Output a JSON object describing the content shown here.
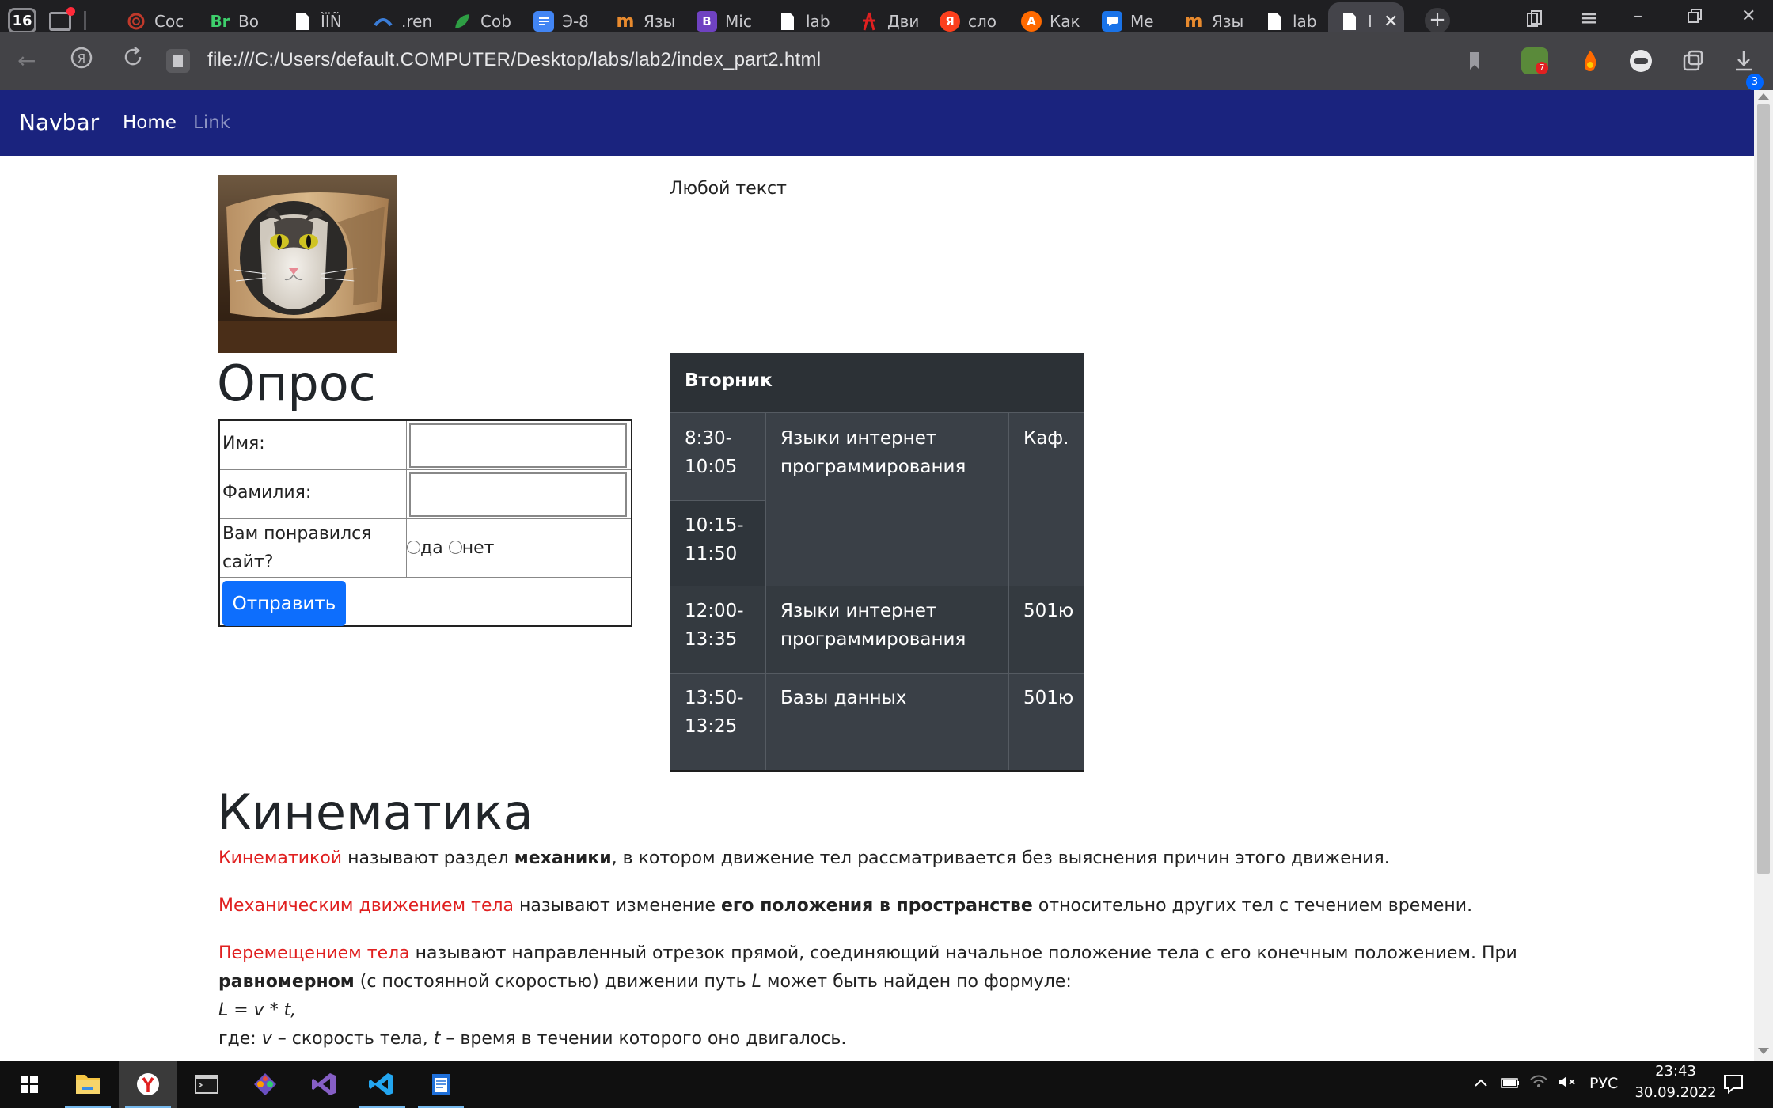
{
  "browser": {
    "tab_count": "16",
    "tabs": [
      {
        "title": "Coc",
        "icon": "red-spiral-icon",
        "color": "#c0392b"
      },
      {
        "title": "Bo",
        "icon": "br-icon",
        "color": "#1e6b3a"
      },
      {
        "title": "ÌÏÑ",
        "icon": "doc-icon",
        "color": "#ffffff"
      },
      {
        "title": ".ren",
        "icon": "wave-icon",
        "color": "#3b7dd8"
      },
      {
        "title": "Cob",
        "icon": "leaf-icon",
        "color": "#2e9e44"
      },
      {
        "title": "Э-8",
        "icon": "docs-icon",
        "color": "#4285f4"
      },
      {
        "title": "Язы",
        "icon": "m-icon",
        "color": "#e88a2e"
      },
      {
        "title": "Mic",
        "icon": "b-icon",
        "color": "#6f42c1"
      },
      {
        "title": "lab",
        "icon": "doc-icon",
        "color": "#ffffff"
      },
      {
        "title": "Дви",
        "icon": "figure-icon",
        "color": "#e02020"
      },
      {
        "title": "сло",
        "icon": "yandex-icon",
        "color": "#fc3f1d"
      },
      {
        "title": "Как",
        "icon": "a-icon",
        "color": "#ff6a00"
      },
      {
        "title": "Ме",
        "icon": "chat-icon",
        "color": "#1a73e8"
      },
      {
        "title": "Язы",
        "icon": "m-icon",
        "color": "#e88a2e"
      },
      {
        "title": "lab",
        "icon": "doc-icon",
        "color": "#ffffff"
      },
      {
        "title": "I",
        "icon": "doc-icon",
        "color": "#ffffff"
      }
    ],
    "url": "file:///C:/Users/default.COMPUTER/Desktop/labs/lab2/index_part2.html",
    "download_badge": "3",
    "extension_badge": "7"
  },
  "navbar": {
    "brand": "Navbar",
    "home": "Home",
    "link": "Link"
  },
  "any_text": "Любой текст",
  "survey": {
    "title": "Опрос",
    "first_name_label": "Имя:",
    "last_name_label": "Фамилия:",
    "liked_label_1": "Вам понравился",
    "liked_label_2": "сайт?",
    "yes": "да",
    "no": "нет",
    "submit": "Отправить"
  },
  "schedule": {
    "day": "Вторник",
    "rows": [
      {
        "time1": "8:30-",
        "time2": "10:05",
        "subject1": "Языки интернет",
        "subject2": "программирования",
        "room": "Каф."
      },
      {
        "time1": "10:15-",
        "time2": "11:50"
      },
      {
        "time1": "12:00-",
        "time2": "13:35",
        "subject1": "Языки интернет",
        "subject2": "программирования",
        "room": "501ю"
      },
      {
        "time1": "13:50-",
        "time2": "13:25",
        "subject1": "Базы данных",
        "room": "501ю"
      }
    ]
  },
  "kinematics": {
    "title": "Кинематика",
    "p1": {
      "term": "Кинематикой",
      "text1": " называют раздел ",
      "bold": "механики",
      "text2": ", в котором движение тел рассматривается без выяснения причин этого движения."
    },
    "p2": {
      "term": "Механическим движением тела",
      "text1": " называют изменение ",
      "bold": "его положения в пространстве",
      "text2": " относительно других тел с течением времени."
    },
    "p3": {
      "term": "Перемещением тела",
      "text1": " называют направленный отрезок прямой, соединяющий начальное положение тела с его конечным положением. При",
      "bold": "равномерном",
      "text2": " (с постоянной скоростью) движении путь ",
      "var_L": "L",
      "text3": " может быть найден по формуле:",
      "formula": "L = v * t,",
      "where_1": "где: ",
      "var_v": "v",
      "where_2": " – скорость тела, ",
      "var_t": "t",
      "where_3": " – время в течении которого оно двигалось."
    }
  },
  "taskbar": {
    "lang": "РУС",
    "time": "23:43",
    "date": "30.09.2022"
  }
}
